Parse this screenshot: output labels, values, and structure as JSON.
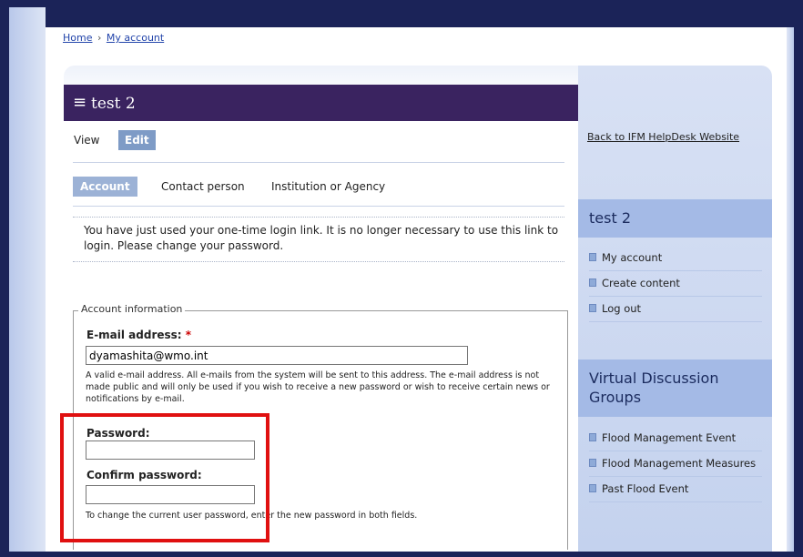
{
  "breadcrumb": {
    "home": "Home",
    "separator": "›",
    "current": "My account"
  },
  "page": {
    "title": "test 2"
  },
  "tabs": {
    "view": "View",
    "edit": "Edit"
  },
  "subtabs": {
    "account": "Account",
    "contact": "Contact person",
    "institution": "Institution or Agency"
  },
  "message": "You have just used your one-time login link. It is no longer necessary to use this link to login. Please change your password.",
  "fieldset": {
    "legend": "Account information",
    "email_label": "E-mail address:",
    "required_mark": "*",
    "email_value": "dyamashita@wmo.int",
    "email_desc": "A valid e-mail address. All e-mails from the system will be sent to this address. The e-mail address is not made public and will only be used if you wish to receive a new password or wish to receive certain news or notifications by e-mail.",
    "password_label": "Password:",
    "password_value": "",
    "confirm_label": "Confirm password:",
    "confirm_value": "",
    "password_desc": "To change the current user password, enter the new password in both fields."
  },
  "sidebar": {
    "back_link": "Back to IFM HelpDesk Website",
    "user_block_title": "test 2",
    "user_menu": [
      "My account",
      "Create content",
      "Log out"
    ],
    "groups_block_title": "Virtual Discussion Groups",
    "groups_menu": [
      "Flood Management Event",
      "Flood Management Measures",
      "Past Flood Event"
    ]
  },
  "colors": {
    "frame": "#1b2358",
    "title_bar": "#3a2360",
    "active_tab": "#7e9bc6",
    "highlight": "#e01010"
  },
  "icons": {
    "title": "menu-icon",
    "menu_bullet": "square-bullet-icon"
  }
}
